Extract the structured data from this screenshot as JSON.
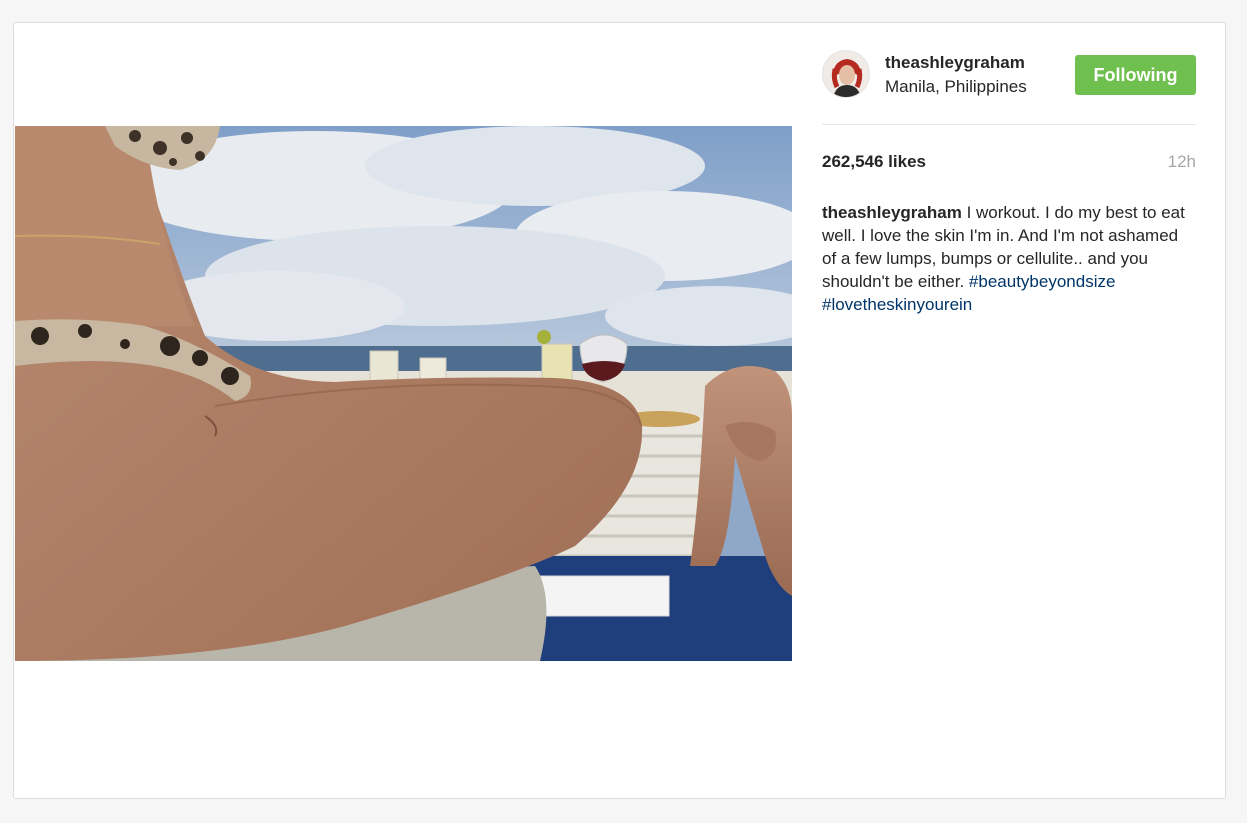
{
  "post": {
    "username": "theashleygraham",
    "location": "Manila, Philippines",
    "follow_button_label": "Following",
    "likes": "262,546 likes",
    "time": "12h",
    "caption": {
      "username": "theashleygraham",
      "text": "I workout. I do my best to eat well. I love the skin I'm in. And I'm not ashamed of a few lumps, bumps or cellulite.. and you shouldn't be either.",
      "hashtags": [
        "#beautybeyondsize",
        "#lovetheskinyourein"
      ]
    },
    "image_icon": "beach-photo",
    "avatar_icon": "profile-photo"
  },
  "colors": {
    "follow_button": "#70c050",
    "hashtag": "#003569",
    "timestamp": "#a5a7aa",
    "text": "#262626"
  }
}
